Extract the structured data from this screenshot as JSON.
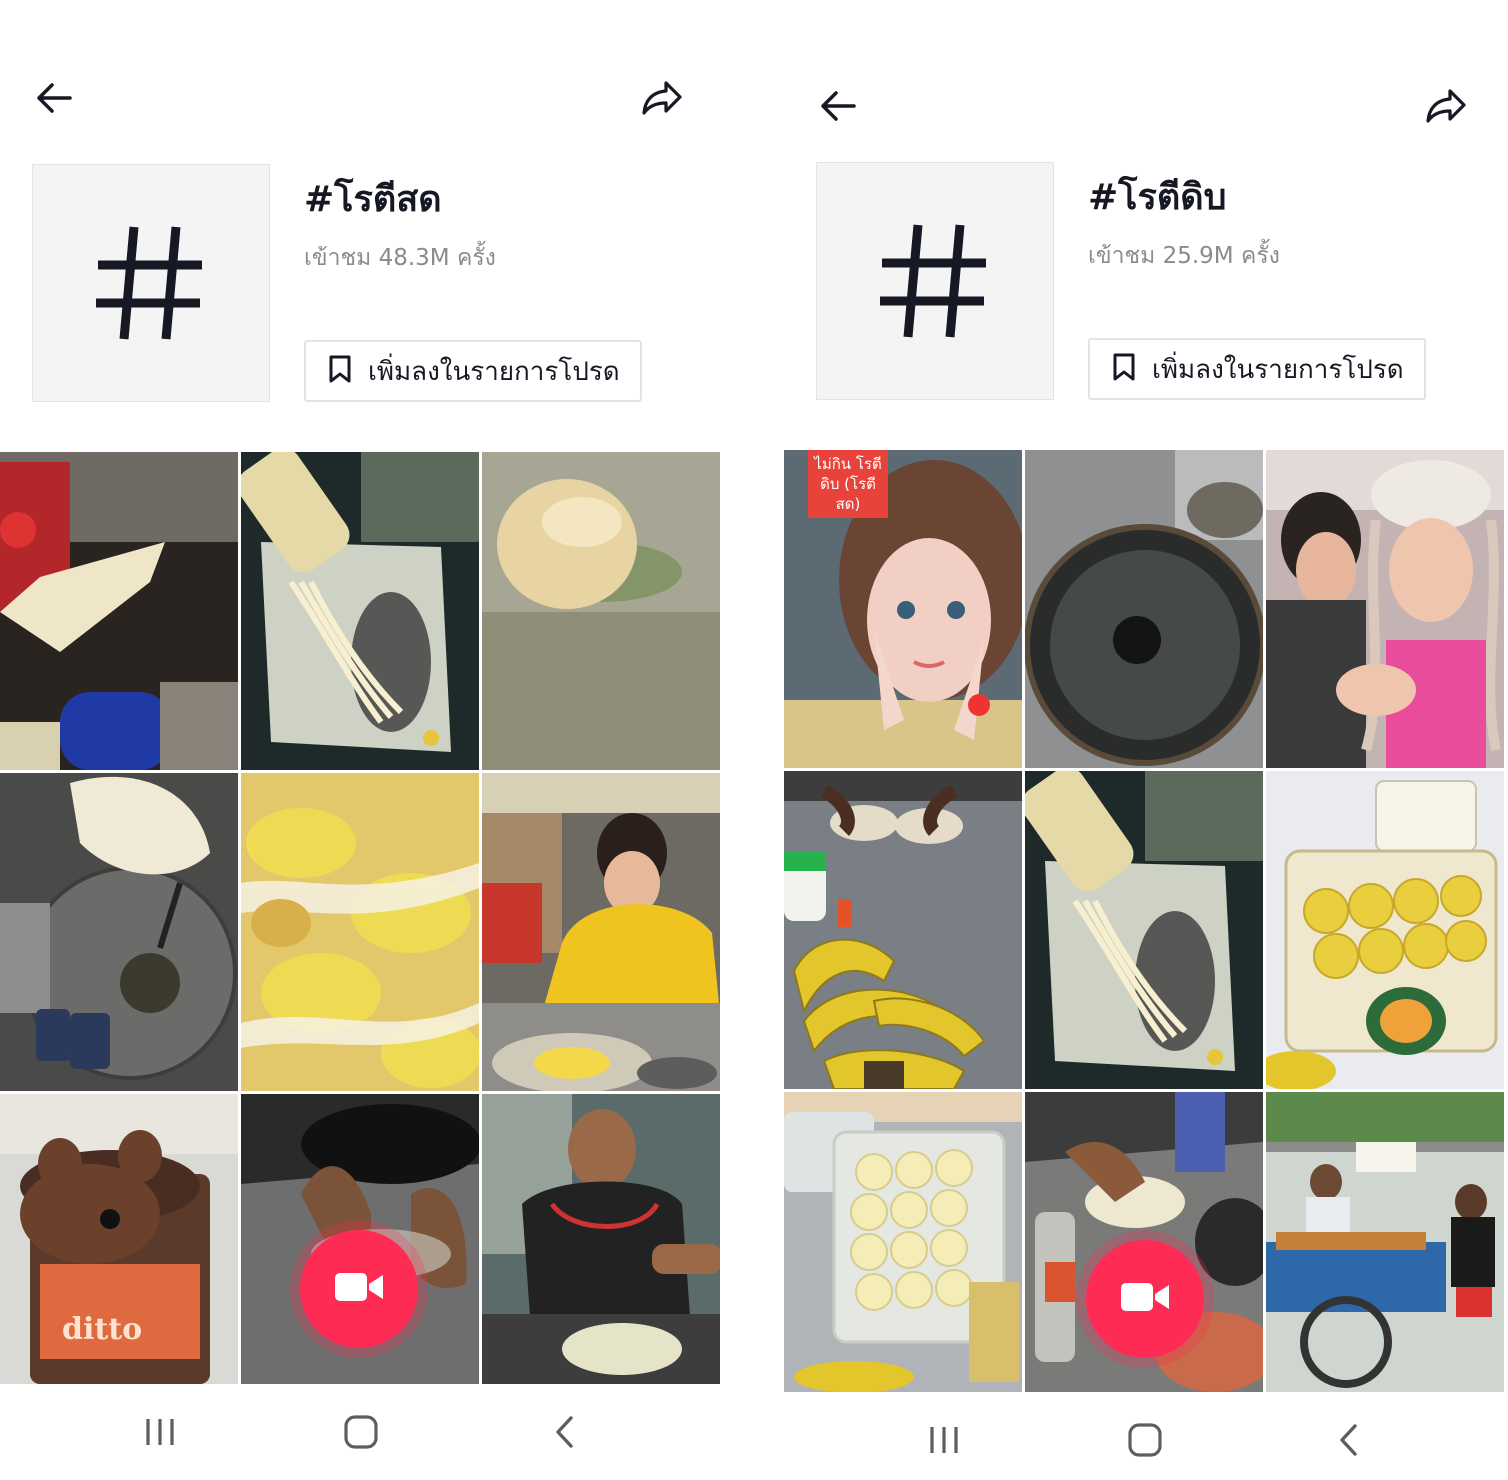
{
  "screens": [
    {
      "hashtag": "#โรตีสด",
      "views": "เข้าชม 48.3M ครั้ง",
      "add_favorites_label": "เพิ่มลงในรายการโปรด",
      "icons": {
        "back": "back-arrow-icon",
        "share": "share-icon",
        "hashtag": "hashtag-icon",
        "bookmark": "bookmark-icon",
        "record": "video-camera-icon"
      },
      "videos": [
        {
          "thumbnail": "man-with-red-apron-pouring-condensed-milk"
        },
        {
          "thumbnail": "condensed-milk-drizzled-on-roti-dough"
        },
        {
          "thumbnail": "dough-ball-on-greased-surface"
        },
        {
          "thumbnail": "stretched-dough-over-hot-griddle"
        },
        {
          "thumbnail": "close-up-egg-roti-with-milk"
        },
        {
          "thumbnail": "woman-in-yellow-making-banana-roti"
        },
        {
          "thumbnail": "ditto-chocolate-bulldog-drink",
          "overlay_text": "ditto"
        },
        {
          "thumbnail": "hands-kneading-dough-on-table"
        },
        {
          "thumbnail": "man-in-black-shirt-making-roti"
        }
      ]
    },
    {
      "hashtag": "#โรตีดิบ",
      "views": "เข้าชม 25.9M ครั้ง",
      "add_favorites_label": "เพิ่มลงในรายการโปรด",
      "icons": {
        "back": "back-arrow-icon",
        "share": "share-icon",
        "hashtag": "hashtag-icon",
        "bookmark": "bookmark-icon",
        "record": "video-camera-icon"
      },
      "videos": [
        {
          "thumbnail": "woman-selfie-with-sticker",
          "overlay_text": "ไม่กิน โรตีดิบ (โรตีสด)"
        },
        {
          "thumbnail": "empty-black-griddle"
        },
        {
          "thumbnail": "couple-with-braided-hair"
        },
        {
          "thumbnail": "bananas-and-dough-on-table"
        },
        {
          "thumbnail": "condensed-milk-drizzled-on-roti-dough"
        },
        {
          "thumbnail": "yellow-dough-balls-in-container"
        },
        {
          "thumbnail": "white-dough-balls-in-container"
        },
        {
          "thumbnail": "hands-spreading-dough"
        },
        {
          "thumbnail": "roti-vendor-cart-blue"
        }
      ]
    }
  ],
  "system_nav": {
    "recents": "recents-icon",
    "home": "home-icon",
    "back": "nav-back-icon"
  },
  "colors": {
    "accent": "#fe2c55",
    "text_primary": "#161823",
    "text_secondary": "#8a8b91",
    "border": "#e3e3e4",
    "hash_box_bg": "#f4f4f4"
  }
}
